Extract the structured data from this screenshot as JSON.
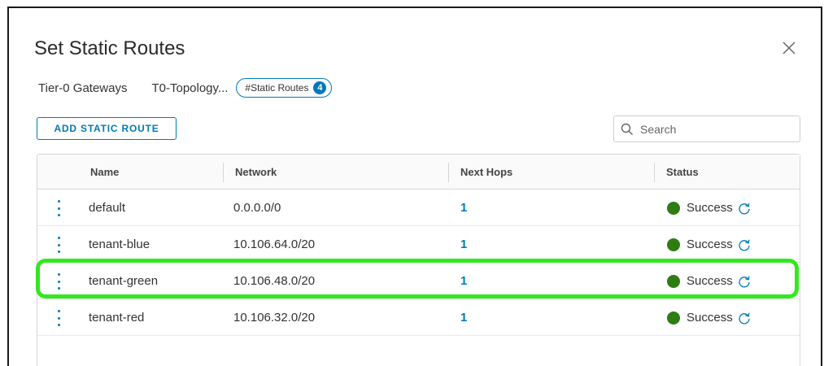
{
  "dialog": {
    "title": "Set Static Routes",
    "close_icon": "close-icon"
  },
  "breadcrumb": {
    "item1": "Tier-0 Gateways",
    "item2": "T0-Topology...",
    "pill_label": "#Static Routes",
    "pill_count": "4"
  },
  "toolbar": {
    "add_label": "ADD STATIC ROUTE",
    "search_placeholder": "Search",
    "search_icon": "search-icon"
  },
  "table": {
    "columns": [
      "Name",
      "Network",
      "Next Hops",
      "Status"
    ],
    "rows": [
      {
        "name": "default",
        "network": "0.0.0.0/0",
        "hops": "1",
        "status": "Success"
      },
      {
        "name": "tenant-blue",
        "network": "10.106.64.0/20",
        "hops": "1",
        "status": "Success"
      },
      {
        "name": "tenant-green",
        "network": "10.106.48.0/20",
        "hops": "1",
        "status": "Success"
      },
      {
        "name": "tenant-red",
        "network": "10.106.32.0/20",
        "hops": "1",
        "status": "Success"
      }
    ]
  },
  "colors": {
    "accent": "#0079b8",
    "success": "#2e7d12",
    "highlight": "#33e81f"
  }
}
